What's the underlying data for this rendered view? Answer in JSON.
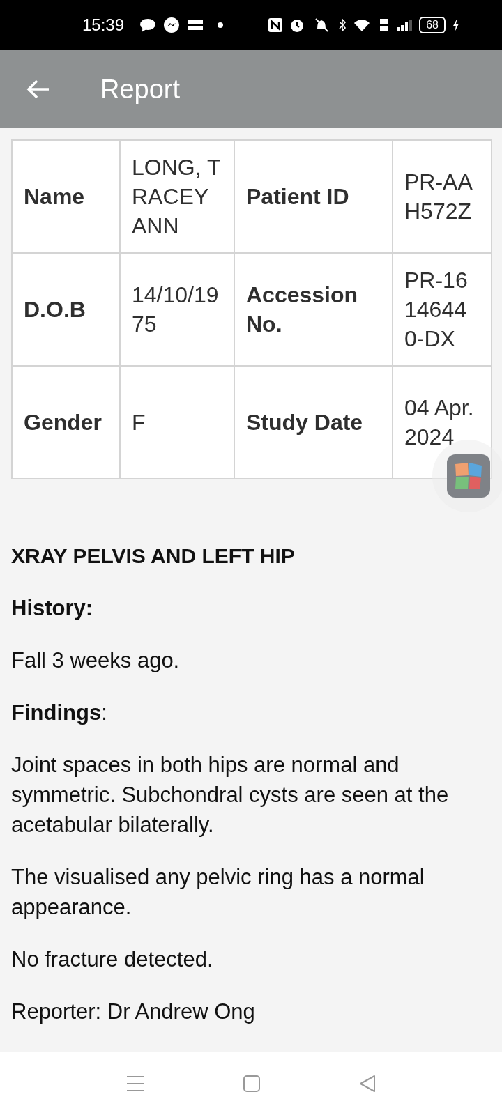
{
  "status_bar": {
    "time": "15:39",
    "battery": "68"
  },
  "app_bar": {
    "title": "Report"
  },
  "table": {
    "rows": [
      [
        {
          "kind": "label",
          "text": "Name"
        },
        {
          "kind": "value",
          "text": "LONG, TRACEY ANN"
        },
        {
          "kind": "label",
          "text": "Patient ID"
        },
        {
          "kind": "value",
          "text": "PR-AAH572Z"
        }
      ],
      [
        {
          "kind": "label",
          "text": "D.O.B"
        },
        {
          "kind": "value",
          "text": "14/10/1975"
        },
        {
          "kind": "label",
          "text": "Accession No."
        },
        {
          "kind": "value",
          "text": "PR-16146440-DX"
        }
      ],
      [
        {
          "kind": "label",
          "text": "Gender"
        },
        {
          "kind": "value",
          "text": "F"
        },
        {
          "kind": "label",
          "text": "Study Date"
        },
        {
          "kind": "value",
          "text": "04 Apr. 2024"
        }
      ]
    ]
  },
  "report": [
    {
      "kind": "title",
      "text": "XRAY PELVIS AND LEFT HIP"
    },
    {
      "kind": "heading",
      "text": "**History:**"
    },
    {
      "kind": "paragraph",
      "text": "Fall 3 weeks ago."
    },
    {
      "kind": "heading",
      "text": "**Findings**:"
    },
    {
      "kind": "paragraph",
      "text": "Joint spaces in both hips are normal and symmetric. Subchondral cysts are seen at the acetabular bilaterally."
    },
    {
      "kind": "paragraph",
      "text": "The visualised any pelvic ring has a normal appearance."
    },
    {
      "kind": "paragraph",
      "text": "No fracture detected."
    },
    {
      "kind": "paragraph",
      "text": "Reporter: Dr Andrew Ong"
    }
  ]
}
